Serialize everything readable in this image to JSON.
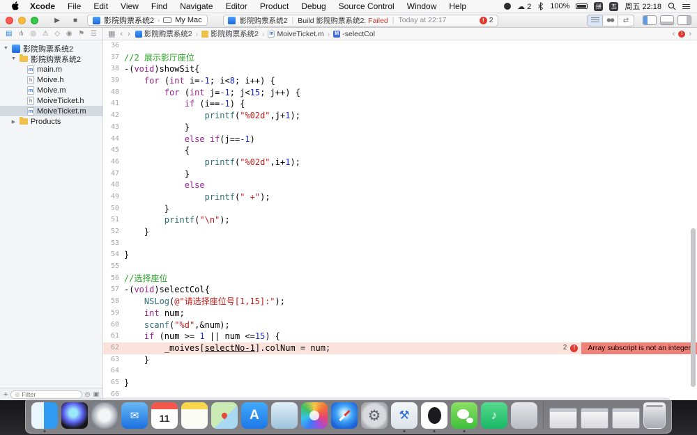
{
  "menubar": {
    "items": [
      "Xcode",
      "File",
      "Edit",
      "View",
      "Find",
      "Navigate",
      "Editor",
      "Product",
      "Debug",
      "Source Control",
      "Window",
      "Help"
    ],
    "status": {
      "cloud_count": "2",
      "battery": "100%",
      "ime_a": "拼",
      "ime_b": "五",
      "clock": "周五 22:18"
    }
  },
  "toolbar": {
    "scheme": {
      "project": "影院购票系统2",
      "destination": "My Mac"
    },
    "activity": {
      "project": "影院购票系统2",
      "build_prefix": "Build 影院购票系统2:",
      "build_status": "Failed",
      "time": "Today at 22:17",
      "error_count": "2"
    }
  },
  "navigator_bar": {
    "items": [
      "project",
      "source-control",
      "find",
      "issues",
      "tests",
      "debug",
      "breakpoints",
      "reports"
    ],
    "selected": "project"
  },
  "jumpbar": {
    "crumbs": [
      {
        "icon": "project",
        "label": "影院购票系统2"
      },
      {
        "icon": "folder",
        "label": "影院购票系统2"
      },
      {
        "icon": "file",
        "label": "MoiveTicket.m"
      },
      {
        "icon": "method",
        "label": "-selectCol"
      }
    ],
    "issue_marker": "!"
  },
  "sidebar": {
    "tree": [
      {
        "label": "影院购票系统2",
        "icon": "project",
        "level": 0,
        "disclosure": "open"
      },
      {
        "label": "影院购票系统2",
        "icon": "folder",
        "level": 1,
        "disclosure": "open"
      },
      {
        "label": "main.m",
        "icon": "m",
        "level": 2
      },
      {
        "label": "Moive.h",
        "icon": "h",
        "level": 2
      },
      {
        "label": "Moive.m",
        "icon": "m",
        "level": 2
      },
      {
        "label": "MoiveTicket.h",
        "icon": "h",
        "level": 2
      },
      {
        "label": "MoiveTicket.m",
        "icon": "m",
        "level": 2,
        "selected": true
      },
      {
        "label": "Products",
        "icon": "folder",
        "level": 1,
        "disclosure": "closed"
      }
    ],
    "filter_placeholder": "Filter"
  },
  "editor": {
    "error_line": 62,
    "error": {
      "count": "2",
      "message": "Array subscript is not an integer"
    },
    "lines": [
      {
        "n": 36,
        "tokens": []
      },
      {
        "n": 37,
        "tokens": [
          [
            "//2 展示影厅座位",
            "c"
          ]
        ]
      },
      {
        "n": 38,
        "tokens": [
          [
            "-(",
            "p"
          ],
          [
            "void",
            "k"
          ],
          [
            ")showSit{",
            "p"
          ]
        ]
      },
      {
        "n": 39,
        "tokens": [
          [
            "    ",
            "p"
          ],
          [
            "for",
            "k"
          ],
          [
            " (",
            "p"
          ],
          [
            "int",
            "k"
          ],
          [
            " i=",
            "p"
          ],
          [
            "-1",
            "n"
          ],
          [
            "; i<",
            "p"
          ],
          [
            "8",
            "n"
          ],
          [
            "; i++) {",
            "p"
          ]
        ]
      },
      {
        "n": 40,
        "tokens": [
          [
            "        ",
            "p"
          ],
          [
            "for",
            "k"
          ],
          [
            " (",
            "p"
          ],
          [
            "int",
            "k"
          ],
          [
            " j=",
            "p"
          ],
          [
            "-1",
            "n"
          ],
          [
            "; j<",
            "p"
          ],
          [
            "15",
            "n"
          ],
          [
            "; j++) {",
            "p"
          ]
        ]
      },
      {
        "n": 41,
        "tokens": [
          [
            "            ",
            "p"
          ],
          [
            "if",
            "k"
          ],
          [
            " (i==",
            "p"
          ],
          [
            "-1",
            "n"
          ],
          [
            ") {",
            "p"
          ]
        ]
      },
      {
        "n": 42,
        "tokens": [
          [
            "                ",
            "p"
          ],
          [
            "printf",
            "f"
          ],
          [
            "(",
            "p"
          ],
          [
            "\"%02d\"",
            "s"
          ],
          [
            ",j+",
            "p"
          ],
          [
            "1",
            "n"
          ],
          [
            ");",
            "p"
          ]
        ]
      },
      {
        "n": 43,
        "tokens": [
          [
            "            }",
            "p"
          ]
        ]
      },
      {
        "n": 44,
        "tokens": [
          [
            "            ",
            "p"
          ],
          [
            "else",
            "k"
          ],
          [
            " ",
            "p"
          ],
          [
            "if",
            "k"
          ],
          [
            "(j==",
            "p"
          ],
          [
            "-1",
            "n"
          ],
          [
            ")",
            "p"
          ]
        ]
      },
      {
        "n": 45,
        "tokens": [
          [
            "            {",
            "p"
          ]
        ]
      },
      {
        "n": 46,
        "tokens": [
          [
            "                ",
            "p"
          ],
          [
            "printf",
            "f"
          ],
          [
            "(",
            "p"
          ],
          [
            "\"%02d\"",
            "s"
          ],
          [
            ",i+",
            "p"
          ],
          [
            "1",
            "n"
          ],
          [
            ");",
            "p"
          ]
        ]
      },
      {
        "n": 47,
        "tokens": [
          [
            "            }",
            "p"
          ]
        ]
      },
      {
        "n": 48,
        "tokens": [
          [
            "            ",
            "p"
          ],
          [
            "else",
            "k"
          ]
        ]
      },
      {
        "n": 49,
        "tokens": [
          [
            "                ",
            "p"
          ],
          [
            "printf",
            "f"
          ],
          [
            "(",
            "p"
          ],
          [
            "\" +\"",
            "s"
          ],
          [
            ");",
            "p"
          ]
        ]
      },
      {
        "n": 50,
        "tokens": [
          [
            "        }",
            "p"
          ]
        ]
      },
      {
        "n": 51,
        "tokens": [
          [
            "        ",
            "p"
          ],
          [
            "printf",
            "f"
          ],
          [
            "(",
            "p"
          ],
          [
            "\"\\n\"",
            "s"
          ],
          [
            ");",
            "p"
          ]
        ]
      },
      {
        "n": 52,
        "tokens": [
          [
            "    }",
            "p"
          ]
        ]
      },
      {
        "n": 53,
        "tokens": []
      },
      {
        "n": 54,
        "tokens": [
          [
            "}",
            "p"
          ]
        ]
      },
      {
        "n": 55,
        "tokens": []
      },
      {
        "n": 56,
        "tokens": [
          [
            "//选择座位",
            "c"
          ]
        ]
      },
      {
        "n": 57,
        "tokens": [
          [
            "-(",
            "p"
          ],
          [
            "void",
            "k"
          ],
          [
            ")selectCol{",
            "p"
          ]
        ]
      },
      {
        "n": 58,
        "tokens": [
          [
            "    ",
            "p"
          ],
          [
            "NSLog",
            "f"
          ],
          [
            "(",
            "p"
          ],
          [
            "@\"请选择座位号[1,15]:\"",
            "s"
          ],
          [
            ");",
            "p"
          ]
        ]
      },
      {
        "n": 59,
        "tokens": [
          [
            "    ",
            "p"
          ],
          [
            "int",
            "k"
          ],
          [
            " num;",
            "p"
          ]
        ]
      },
      {
        "n": 60,
        "tokens": [
          [
            "    ",
            "p"
          ],
          [
            "scanf",
            "f"
          ],
          [
            "(",
            "p"
          ],
          [
            "\"%d\"",
            "s"
          ],
          [
            ",&num);",
            "p"
          ]
        ]
      },
      {
        "n": 61,
        "tokens": [
          [
            "    ",
            "p"
          ],
          [
            "if",
            "k"
          ],
          [
            " (num >= ",
            "p"
          ],
          [
            "1",
            "n"
          ],
          [
            " || num <=",
            "p"
          ],
          [
            "15",
            "n"
          ],
          [
            ") {",
            "p"
          ]
        ]
      },
      {
        "n": 62,
        "tokens": [
          [
            "        _moives[",
            "p"
          ],
          [
            "selectNo-1",
            "u"
          ],
          [
            "].colNum = num;",
            "p"
          ]
        ]
      },
      {
        "n": 63,
        "tokens": [
          [
            "    }",
            "p"
          ]
        ]
      },
      {
        "n": 64,
        "tokens": []
      },
      {
        "n": 65,
        "tokens": [
          [
            "}",
            "p"
          ]
        ]
      },
      {
        "n": 66,
        "tokens": []
      }
    ]
  },
  "dock": {
    "apps": [
      {
        "name": "finder",
        "style": "finder",
        "running": true
      },
      {
        "name": "siri",
        "style": "siri"
      },
      {
        "name": "launchpad",
        "style": "launchpad"
      },
      {
        "name": "mail",
        "style": "mail",
        "glyph": "✉"
      },
      {
        "name": "calendar",
        "style": "calendar",
        "glyph": "11"
      },
      {
        "name": "notes",
        "style": "notes"
      },
      {
        "name": "maps",
        "style": "maps"
      },
      {
        "name": "app-store",
        "style": "appstore",
        "glyph": "A"
      },
      {
        "name": "preview",
        "style": "preview"
      },
      {
        "name": "photos",
        "style": "photos"
      },
      {
        "name": "safari",
        "style": "safari"
      },
      {
        "name": "system-preferences",
        "style": "prefs",
        "glyph": "⚙"
      },
      {
        "name": "xcode",
        "style": "xcode",
        "glyph": "⚒",
        "running": true
      },
      {
        "name": "qq",
        "style": "qq",
        "running": true
      },
      {
        "name": "wechat",
        "style": "wechat",
        "running": true
      },
      {
        "name": "qq-music",
        "style": "qqmusic",
        "glyph": "♪"
      },
      {
        "name": "other-app",
        "style": "generic"
      }
    ],
    "minimized_windows": 3,
    "has_trash": true
  },
  "colors": {
    "keyword": "#9B2393",
    "comment": "#28A125",
    "string": "#C41A16",
    "number": "#1C28D6",
    "function": "#2E6F74",
    "error_banner": "#EE8278",
    "error_dot": "#DE3A2F",
    "selection": "#D3DAE2",
    "accent": "#1779D6"
  }
}
